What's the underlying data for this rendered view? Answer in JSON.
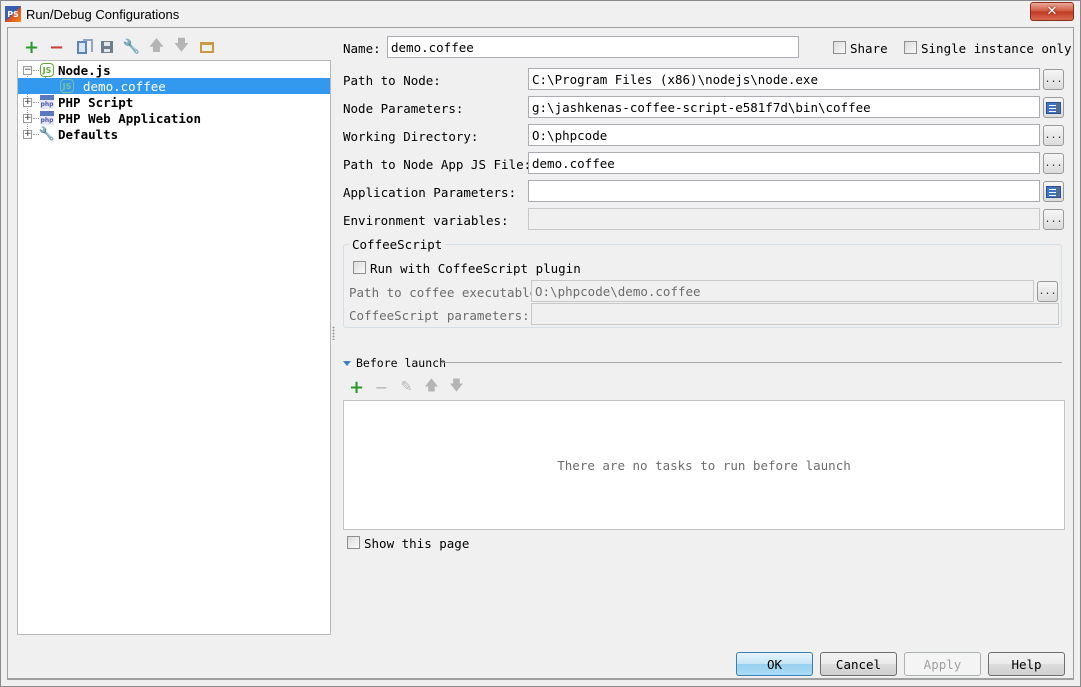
{
  "window": {
    "title": "Run/Debug Configurations",
    "app_icon": "phpstorm-icon",
    "close_label": "✕"
  },
  "left_toolbar": {
    "buttons": [
      {
        "name": "add",
        "icon": "plus-icon",
        "glyph": "+",
        "enabled": true
      },
      {
        "name": "remove",
        "icon": "minus-icon",
        "glyph": "−",
        "enabled": true
      },
      {
        "name": "copy",
        "icon": "copy-icon",
        "enabled": true
      },
      {
        "name": "save",
        "icon": "save-icon",
        "enabled": true
      },
      {
        "name": "edit-defaults",
        "icon": "wrench-icon",
        "glyph": "🔧",
        "enabled": true
      },
      {
        "name": "move-up",
        "icon": "arrow-up-icon",
        "glyph": "🡅",
        "enabled": false
      },
      {
        "name": "move-down",
        "icon": "arrow-down-icon",
        "glyph": "🡇",
        "enabled": false
      },
      {
        "name": "folder",
        "icon": "folder-icon",
        "enabled": true
      }
    ]
  },
  "tree": {
    "items": [
      {
        "label": "Node.js",
        "expanded": true,
        "icon": "nodejs-icon",
        "icon_text": "JS",
        "expander": "−"
      },
      {
        "label": "demo.coffee",
        "selected": true,
        "icon": "nodejs-icon",
        "icon_text": "JS",
        "child": true
      },
      {
        "label": "PHP Script",
        "expanded": false,
        "icon": "php-script-icon",
        "icon_text": "php",
        "expander": "+"
      },
      {
        "label": "PHP Web Application",
        "expanded": false,
        "icon": "php-web-icon",
        "icon_text": "php",
        "expander": "+"
      },
      {
        "label": "Defaults",
        "expanded": false,
        "icon": "wrench-icon",
        "icon_text": "🔧",
        "expander": "+"
      }
    ]
  },
  "form": {
    "name_label": "Name:",
    "name_value": "demo.coffee",
    "share_label": "Share",
    "share_checked": false,
    "single_instance_label": "Single instance only",
    "single_instance_checked": false,
    "fields": [
      {
        "label": "Path to Node:",
        "value": "C:\\Program Files (x86)\\nodejs\\node.exe",
        "button": "ellipsis",
        "enabled": true
      },
      {
        "label": "Node Parameters:",
        "value": "g:\\jashkenas-coffee-script-e581f7d\\bin\\coffee",
        "button": "expand",
        "enabled": true
      },
      {
        "label": "Working Directory:",
        "value": "O:\\phpcode",
        "button": "ellipsis",
        "enabled": true
      },
      {
        "label": "Path to Node App JS File:",
        "value": "demo.coffee",
        "button": "ellipsis",
        "enabled": true
      },
      {
        "label": "Application Parameters:",
        "value": "",
        "button": "expand",
        "enabled": true
      },
      {
        "label": "Environment variables:",
        "value": "",
        "button": "ellipsis",
        "enabled": false
      }
    ],
    "ellipsis_label": "...",
    "coffeescript": {
      "title": "CoffeeScript",
      "run_with_plugin_label": "Run with CoffeeScript plugin",
      "run_with_plugin_checked": false,
      "path_label": "Path to coffee executable:",
      "path_value": "O:\\phpcode\\demo.coffee",
      "params_label": "CoffeeScript parameters:",
      "params_value": ""
    }
  },
  "before_launch": {
    "title": "Before launch",
    "toolbar": [
      {
        "name": "add",
        "icon": "plus-icon",
        "glyph": "+",
        "enabled": true
      },
      {
        "name": "remove",
        "icon": "minus-icon",
        "glyph": "−",
        "enabled": false
      },
      {
        "name": "edit",
        "icon": "pencil-icon",
        "glyph": "✎",
        "enabled": false
      },
      {
        "name": "move-up",
        "icon": "arrow-up-icon",
        "glyph": "🡅",
        "enabled": false
      },
      {
        "name": "move-down",
        "icon": "arrow-down-icon",
        "glyph": "🡇",
        "enabled": false
      }
    ],
    "empty_text": "There are no tasks to run before launch",
    "show_page_label": "Show this page",
    "show_page_checked": false
  },
  "buttons": {
    "ok": "OK",
    "cancel": "Cancel",
    "apply": "Apply",
    "help": "Help"
  },
  "colors": {
    "selection": "#3399ee",
    "add_green": "#2a9a2a",
    "remove_red": "#c8413a",
    "background": "#f0f0f0"
  }
}
